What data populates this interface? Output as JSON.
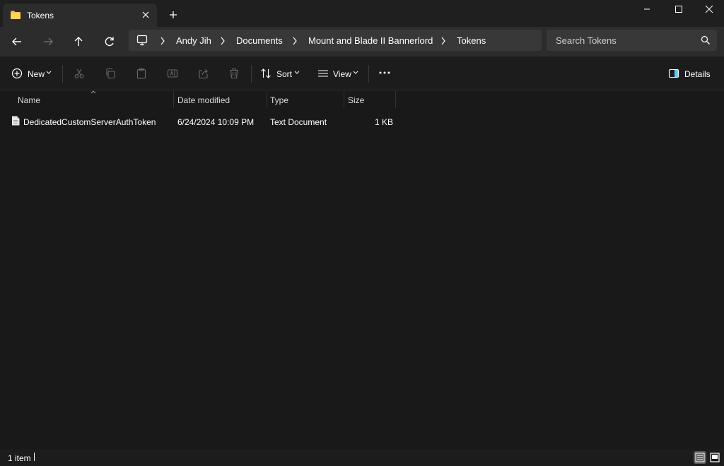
{
  "window": {
    "tab_title": "Tokens",
    "icons": {
      "tab": "folder-icon",
      "close_tab": "close-icon",
      "new_tab": "plus-icon"
    }
  },
  "address": {
    "crumbs": [
      "Andy Jih",
      "Documents",
      "Mount and Blade II Bannerlord",
      "Tokens"
    ],
    "search_placeholder": "Search Tokens"
  },
  "toolbar": {
    "new_label": "New",
    "sort_label": "Sort",
    "view_label": "View",
    "details_label": "Details"
  },
  "columns": [
    "Name",
    "Date modified",
    "Type",
    "Size"
  ],
  "files": [
    {
      "name": "DedicatedCustomServerAuthToken",
      "date_modified": "6/24/2024 10:09 PM",
      "type": "Text Document",
      "size": "1 KB"
    }
  ],
  "status": {
    "item_count": "1 item"
  },
  "colors": {
    "background": "#191919",
    "tab": "#2c2c2c",
    "address_field": "#383838",
    "folder": "#f5c242",
    "accent": "#60cdff"
  }
}
